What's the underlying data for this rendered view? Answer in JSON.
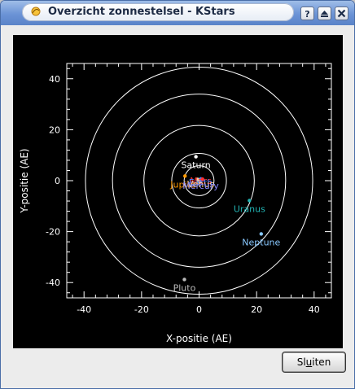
{
  "window": {
    "title": "Overzicht zonnestelsel - KStars",
    "help_button": "?",
    "colors": {
      "titlebar": "#6b93d6",
      "plot_bg": "#000000",
      "axis": "#ffffff"
    }
  },
  "chart_data": {
    "type": "scatter",
    "xlabel": "X-positie (AE)",
    "ylabel": "Y-positie (AE)",
    "xlim": [
      -46,
      46
    ],
    "ylim": [
      -46,
      46
    ],
    "major_ticks": [
      -40,
      -20,
      0,
      20,
      40
    ],
    "tick_labels": [
      "-40",
      "-20",
      "0",
      "20",
      "40"
    ],
    "orbits_au": [
      5.2,
      9.5,
      19.2,
      30.1,
      39.5
    ],
    "planets": [
      {
        "name": "Mercury",
        "x": 0.2,
        "y": -0.3,
        "color": "#c0c0c0",
        "label_color": "#c0c0c0",
        "show_label": false
      },
      {
        "name": "Venus",
        "x": -0.5,
        "y": 0.5,
        "color": "#ffd0a0",
        "label_color": "#ffd0a0",
        "show_label": false
      },
      {
        "name": "Earth",
        "x": 0.6,
        "y": 0.7,
        "color": "#4080ff",
        "label_color": "#4080ff",
        "show_label": false
      },
      {
        "name": "Mars",
        "x": 1.2,
        "y": 0.6,
        "color": "#ff3030",
        "label_color": "#ff3030",
        "show_label": false
      },
      {
        "name": "Jupiter",
        "x": -4.9,
        "y": 1.8,
        "color": "#ff9900",
        "label_color": "#ff9900",
        "show_label": true
      },
      {
        "name": "Saturn",
        "x": -1.1,
        "y": 9.4,
        "color": "#ffffff",
        "label_color": "#ffffff",
        "show_label": true
      },
      {
        "name": "Uranus",
        "x": 17.5,
        "y": -7.8,
        "color": "#22b3b3",
        "label_color": "#22b3b3",
        "show_label": true
      },
      {
        "name": "Neptune",
        "x": 21.6,
        "y": -20.9,
        "color": "#88c8ff",
        "label_color": "#88c8ff",
        "show_label": true
      },
      {
        "name": "Pluto",
        "x": -5.1,
        "y": -38.8,
        "color": "#bbbbbb",
        "label_color": "#bbbbbb",
        "show_label": true
      }
    ],
    "center_labels": [
      "Mars",
      "Earth",
      "Venus",
      "Mercury"
    ],
    "center_label_colors": [
      "#ff3030",
      "#4080ff",
      "#ffd0a0",
      "#8888ff"
    ]
  },
  "footer": {
    "close_button": {
      "prefix": "Sl",
      "underline": "u",
      "suffix": "iten"
    }
  }
}
